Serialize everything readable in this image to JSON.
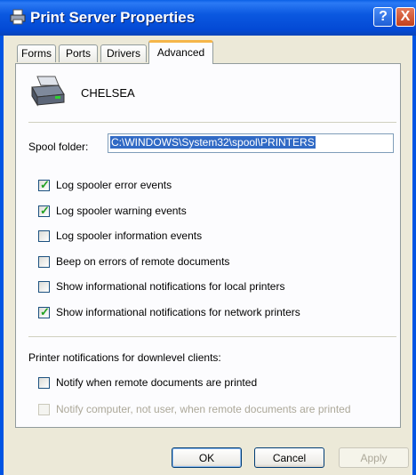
{
  "window": {
    "title": "Print Server Properties",
    "help_label": "?",
    "close_label": "X"
  },
  "tabs": [
    {
      "label": "Forms"
    },
    {
      "label": "Ports"
    },
    {
      "label": "Drivers"
    },
    {
      "label": "Advanced",
      "active": true
    }
  ],
  "advanced": {
    "server_name": "CHELSEA",
    "spool_folder_label": "Spool folder:",
    "spool_folder_value": "C:\\WINDOWS\\System32\\spool\\PRINTERS",
    "options": [
      {
        "label": "Log spooler error events",
        "checked": true
      },
      {
        "label": "Log spooler warning events",
        "checked": true
      },
      {
        "label": "Log spooler information events",
        "checked": false
      },
      {
        "label": "Beep on errors of remote documents",
        "checked": false
      },
      {
        "label": "Show informational notifications for local printers",
        "checked": false
      },
      {
        "label": "Show informational notifications for network printers",
        "checked": true
      }
    ],
    "downlevel_label": "Printer notifications for downlevel clients:",
    "downlevel_options": [
      {
        "label": "Notify when remote documents are printed",
        "checked": false,
        "enabled": true
      },
      {
        "label": "Notify computer, not user, when remote documents are printed",
        "checked": false,
        "enabled": false
      }
    ]
  },
  "buttons": {
    "ok": "OK",
    "cancel": "Cancel",
    "apply": "Apply"
  },
  "colors": {
    "titlebar": "#0054e3",
    "active_tab_highlight": "#f5b64a",
    "selection": "#316ac5",
    "check": "#21a121"
  }
}
